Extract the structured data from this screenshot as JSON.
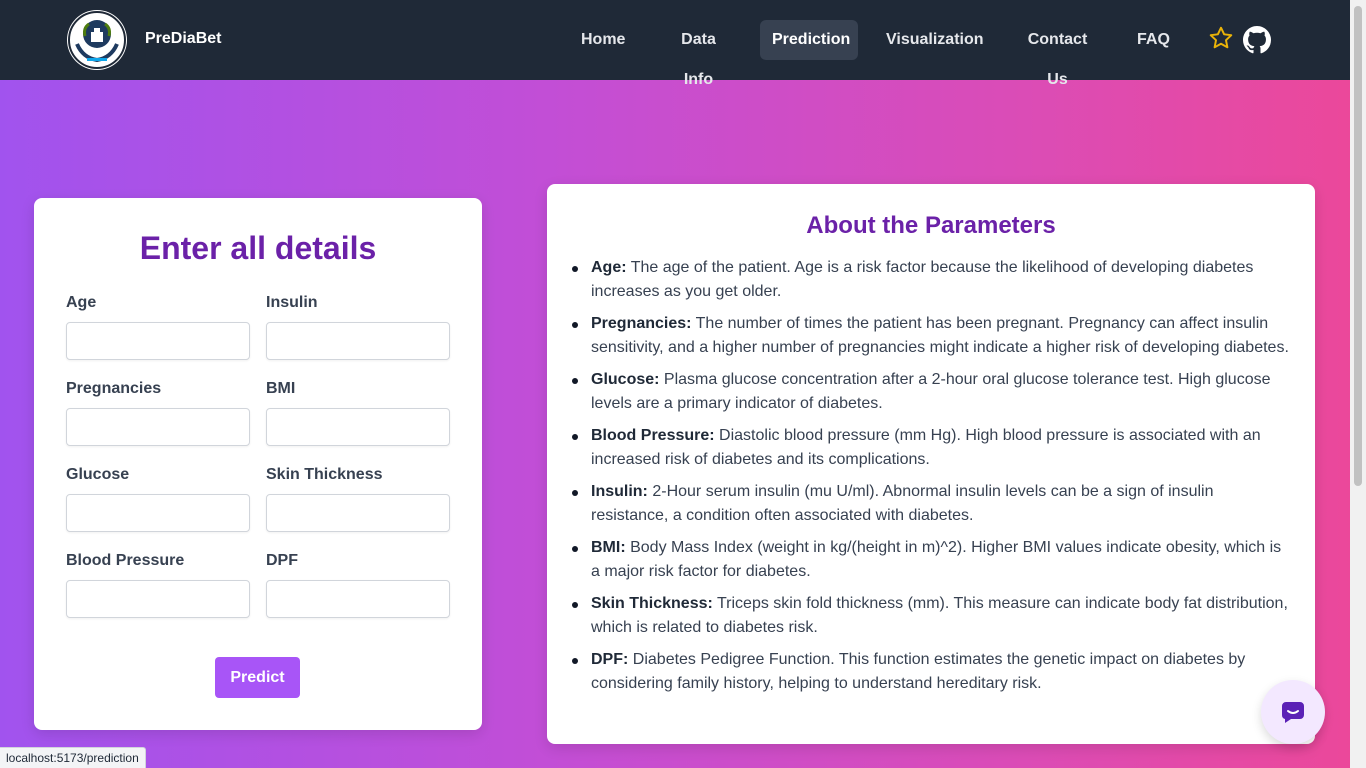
{
  "nav": {
    "brand": "PreDiaBet",
    "links": [
      {
        "label": "Home",
        "active": false
      },
      {
        "label": "Data Info",
        "active": false
      },
      {
        "label": "Prediction",
        "active": true
      },
      {
        "label": "Visualization",
        "active": false
      },
      {
        "label": "Contact Us",
        "active": false
      },
      {
        "label": "FAQ",
        "active": false
      }
    ],
    "icons": [
      "star-icon",
      "github-icon"
    ]
  },
  "form": {
    "title": "Enter all details",
    "fields": [
      {
        "label": "Age",
        "value": ""
      },
      {
        "label": "Insulin",
        "value": ""
      },
      {
        "label": "Pregnancies",
        "value": ""
      },
      {
        "label": "BMI",
        "value": ""
      },
      {
        "label": "Glucose",
        "value": ""
      },
      {
        "label": "Skin Thickness",
        "value": ""
      },
      {
        "label": "Blood Pressure",
        "value": ""
      },
      {
        "label": "DPF",
        "value": ""
      }
    ],
    "submit_label": "Predict"
  },
  "about": {
    "title": "About the Parameters",
    "items": [
      {
        "name": "Age:",
        "desc": "The age of the patient. Age is a risk factor because the likelihood of developing diabetes increases as you get older."
      },
      {
        "name": "Pregnancies:",
        "desc": "The number of times the patient has been pregnant. Pregnancy can affect insulin sensitivity, and a higher number of pregnancies might indicate a higher risk of developing diabetes."
      },
      {
        "name": "Glucose:",
        "desc": "Plasma glucose concentration after a 2-hour oral glucose tolerance test. High glucose levels are a primary indicator of diabetes."
      },
      {
        "name": "Blood Pressure:",
        "desc": "Diastolic blood pressure (mm Hg). High blood pressure is associated with an increased risk of diabetes and its complications."
      },
      {
        "name": "Insulin:",
        "desc": "2-Hour serum insulin (mu U/ml). Abnormal insulin levels can be a sign of insulin resistance, a condition often associated with diabetes."
      },
      {
        "name": "BMI:",
        "desc": "Body Mass Index (weight in kg/(height in m)^2). Higher BMI values indicate obesity, which is a major risk factor for diabetes."
      },
      {
        "name": "Skin Thickness:",
        "desc": "Triceps skin fold thickness (mm). This measure can indicate body fat distribution, which is related to diabetes risk."
      },
      {
        "name": "DPF:",
        "desc": "Diabetes Pedigree Function. This function estimates the genetic impact on diabetes by considering family history, helping to understand hereditary risk."
      }
    ]
  },
  "chat": {
    "icon": "chat-bubble-icon"
  },
  "status_bar": {
    "url": "localhost:5173/prediction"
  },
  "colors": {
    "nav_bg": "#1f2937",
    "accent": "#a855f7",
    "heading": "#6b21a8",
    "star": "#eab308"
  }
}
